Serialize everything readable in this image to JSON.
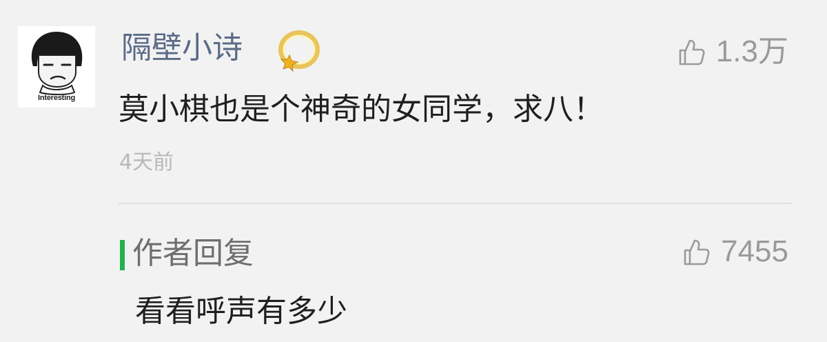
{
  "comment": {
    "avatar_caption": "Interesting",
    "username": "隔壁小诗",
    "badge_icon": "sparkle-circle-icon",
    "likes": "1.3万",
    "text": "莫小棋也是个神奇的女同学，求八！",
    "time": "4天前"
  },
  "reply": {
    "label": "作者回复",
    "likes": "7455",
    "text": "看看呼声有多少"
  },
  "colors": {
    "username": "#5b6b86",
    "reply_marker": "#22b14c",
    "muted": "#9a9a9a",
    "text": "#1f1f1f",
    "background": "#f2f2f2"
  }
}
